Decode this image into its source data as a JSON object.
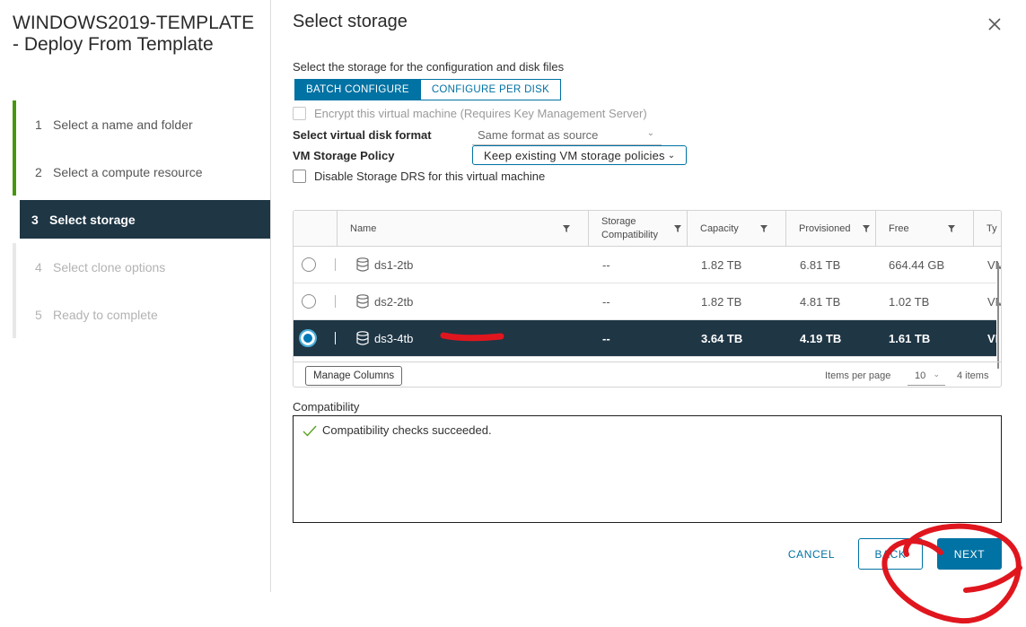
{
  "wizard": {
    "title": "WINDOWS2019-TEMPLATE - Deploy From Template",
    "steps": [
      {
        "num": "1",
        "label": "Select a name and folder"
      },
      {
        "num": "2",
        "label": "Select a compute resource"
      },
      {
        "num": "3",
        "label": "Select storage"
      },
      {
        "num": "4",
        "label": "Select clone options"
      },
      {
        "num": "5",
        "label": "Ready to complete"
      }
    ]
  },
  "page": {
    "title": "Select storage",
    "instruction": "Select the storage for the configuration and disk files",
    "configure_buttons": [
      "BATCH CONFIGURE",
      "CONFIGURE PER DISK"
    ],
    "encrypt_label": "Encrypt this virtual machine (Requires Key Management Server)",
    "disk_format_label": "Select virtual disk format",
    "disk_format_value": "Same format as source",
    "storage_policy_label": "VM Storage Policy",
    "storage_policy_value": "Keep existing VM storage policies",
    "disable_drs_label": "Disable Storage DRS for this virtual machine"
  },
  "grid": {
    "columns": [
      "Name",
      "Storage Compatibility",
      "Capacity",
      "Provisioned",
      "Free",
      "Ty"
    ],
    "rows": [
      {
        "name": "ds1-2tb",
        "compat": "--",
        "capacity": "1.82 TB",
        "provisioned": "6.81 TB",
        "free": "664.44 GB",
        "type": "VM"
      },
      {
        "name": "ds2-2tb",
        "compat": "--",
        "capacity": "1.82 TB",
        "provisioned": "4.81 TB",
        "free": "1.02 TB",
        "type": "VM"
      },
      {
        "name": "ds3-4tb",
        "compat": "--",
        "capacity": "3.64 TB",
        "provisioned": "4.19 TB",
        "free": "1.61 TB",
        "type": "VM"
      }
    ],
    "selected_row": 2,
    "manage_columns": "Manage Columns",
    "items_per_page_label": "Items per page",
    "items_per_page": "10",
    "item_count": "4 items"
  },
  "compatibility": {
    "label": "Compatibility",
    "message": "Compatibility checks succeeded."
  },
  "footer": {
    "cancel": "CANCEL",
    "back": "BACK",
    "next": "NEXT"
  },
  "colors": {
    "accent": "#0072a3",
    "selected_bg": "#1f3645",
    "done_step": "#48960c",
    "annotation": "#e0161e"
  }
}
